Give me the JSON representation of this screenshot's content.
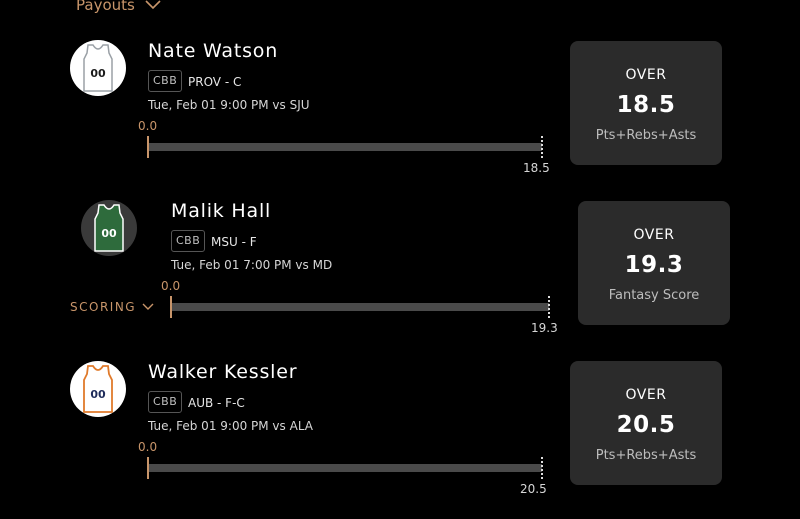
{
  "header": {
    "payouts_label": "Payouts"
  },
  "picks": [
    {
      "name": "Nate Watson",
      "league": "CBB",
      "team_pos": "PROV - C",
      "game": "Tue, Feb 01 9:00 PM vs SJU",
      "min": "0.0",
      "max": "18.5",
      "progress": 0,
      "direction": "OVER",
      "line": "18.5",
      "stat": "Pts+Rebs+Asts",
      "jersey_number": "00",
      "jersey_colors": {
        "body": "#ffffff",
        "trim": "#9aa0a6",
        "text": "#1a1a1a"
      }
    },
    {
      "name": "Malik Hall",
      "league": "CBB",
      "team_pos": "MSU - F",
      "game": "Tue, Feb 01 7:00 PM vs MD",
      "min": "0.0",
      "max": "19.3",
      "progress": 0,
      "scoring_label": "SCORING",
      "direction": "OVER",
      "line": "19.3",
      "stat": "Fantasy Score",
      "jersey_number": "00",
      "jersey_colors": {
        "body": "#2e6b3c",
        "trim": "#ffffff",
        "text": "#ffffff"
      }
    },
    {
      "name": "Walker Kessler",
      "league": "CBB",
      "team_pos": "AUB - F-C",
      "game": "Tue, Feb 01 9:00 PM vs ALA",
      "min": "0.0",
      "max": "20.5",
      "progress": 0,
      "direction": "OVER",
      "line": "20.5",
      "stat": "Pts+Rebs+Asts",
      "jersey_number": "00",
      "jersey_colors": {
        "body": "#ffffff",
        "trim": "#e07a2b",
        "text": "#1d2b5a"
      }
    }
  ],
  "colors": {
    "accent": "#c8956a",
    "card_bg": "#2b2b2b",
    "track": "#4a4a4a"
  }
}
